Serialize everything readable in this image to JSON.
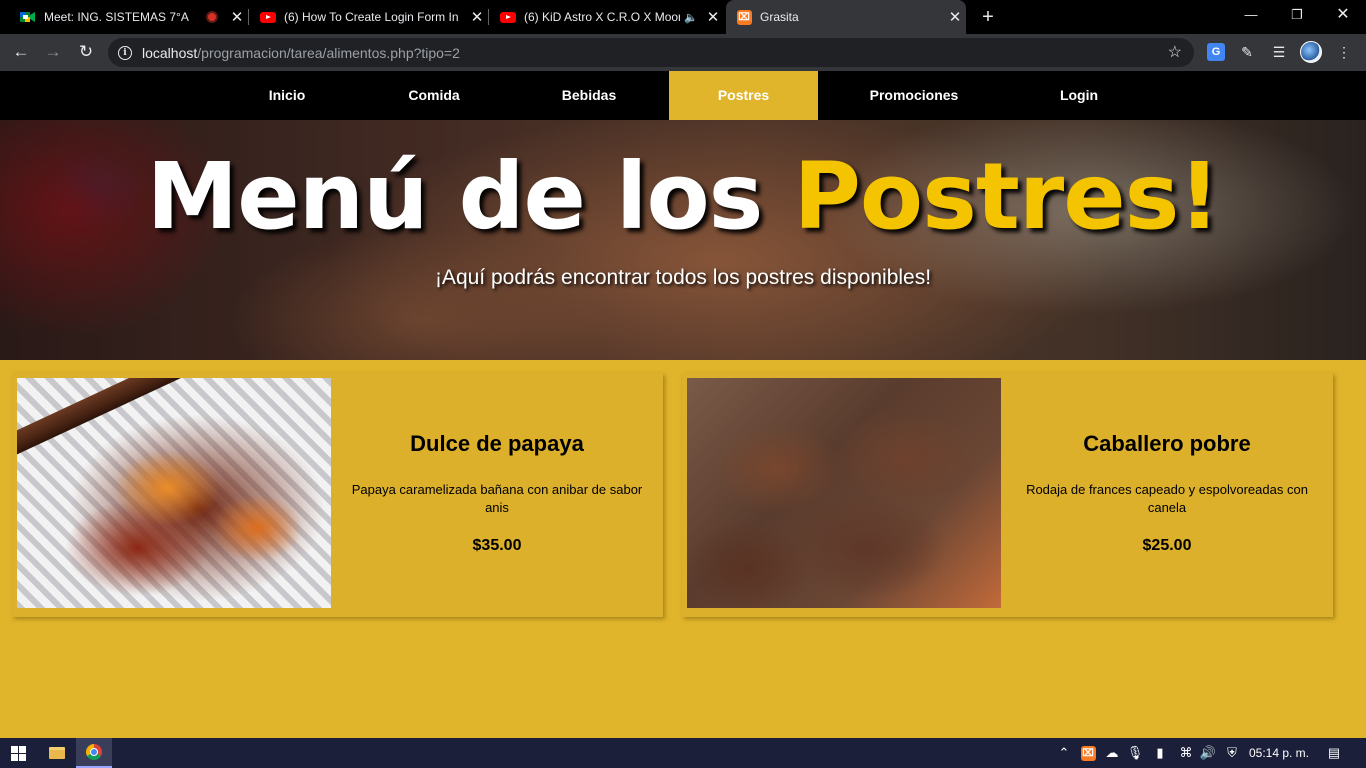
{
  "browser": {
    "tabs": [
      {
        "title": "Meet: ING. SISTEMAS 7°A",
        "icon": "google-meet-icon"
      },
      {
        "title": "(6) How To Create Login Form In",
        "icon": "youtube-icon"
      },
      {
        "title": "(6) KiD Astro X C.R.O X Moon",
        "icon": "youtube-icon"
      },
      {
        "title": "Grasita",
        "icon": "xampp-icon"
      }
    ],
    "url_host": "localhost",
    "url_path": "/programacion/tarea/alimentos.php?tipo=2",
    "new_tab": "+",
    "close_glyph": "✕",
    "minimize_glyph": "—",
    "restore_glyph": "❐",
    "close_window_glyph": "✕"
  },
  "site": {
    "nav": [
      "Inicio",
      "Comida",
      "Bebidas",
      "Postres",
      "Promociones",
      "Login"
    ],
    "active_nav": "Postres",
    "hero_title_main": "Menú de los ",
    "hero_title_accent": "Postres!",
    "hero_subtitle": "¡Aquí podrás encontrar todos los postres disponibles!",
    "accent_color": "#e0b52b",
    "products": [
      {
        "name": "Dulce de papaya",
        "description": "Papaya caramelizada bañana con anibar de sabor anis",
        "price": "$35.00"
      },
      {
        "name": "Caballero pobre",
        "description": "Rodaja de frances capeado y espolvoreadas con canela",
        "price": "$25.00"
      }
    ]
  },
  "taskbar": {
    "clock": "05:14 p. m."
  }
}
